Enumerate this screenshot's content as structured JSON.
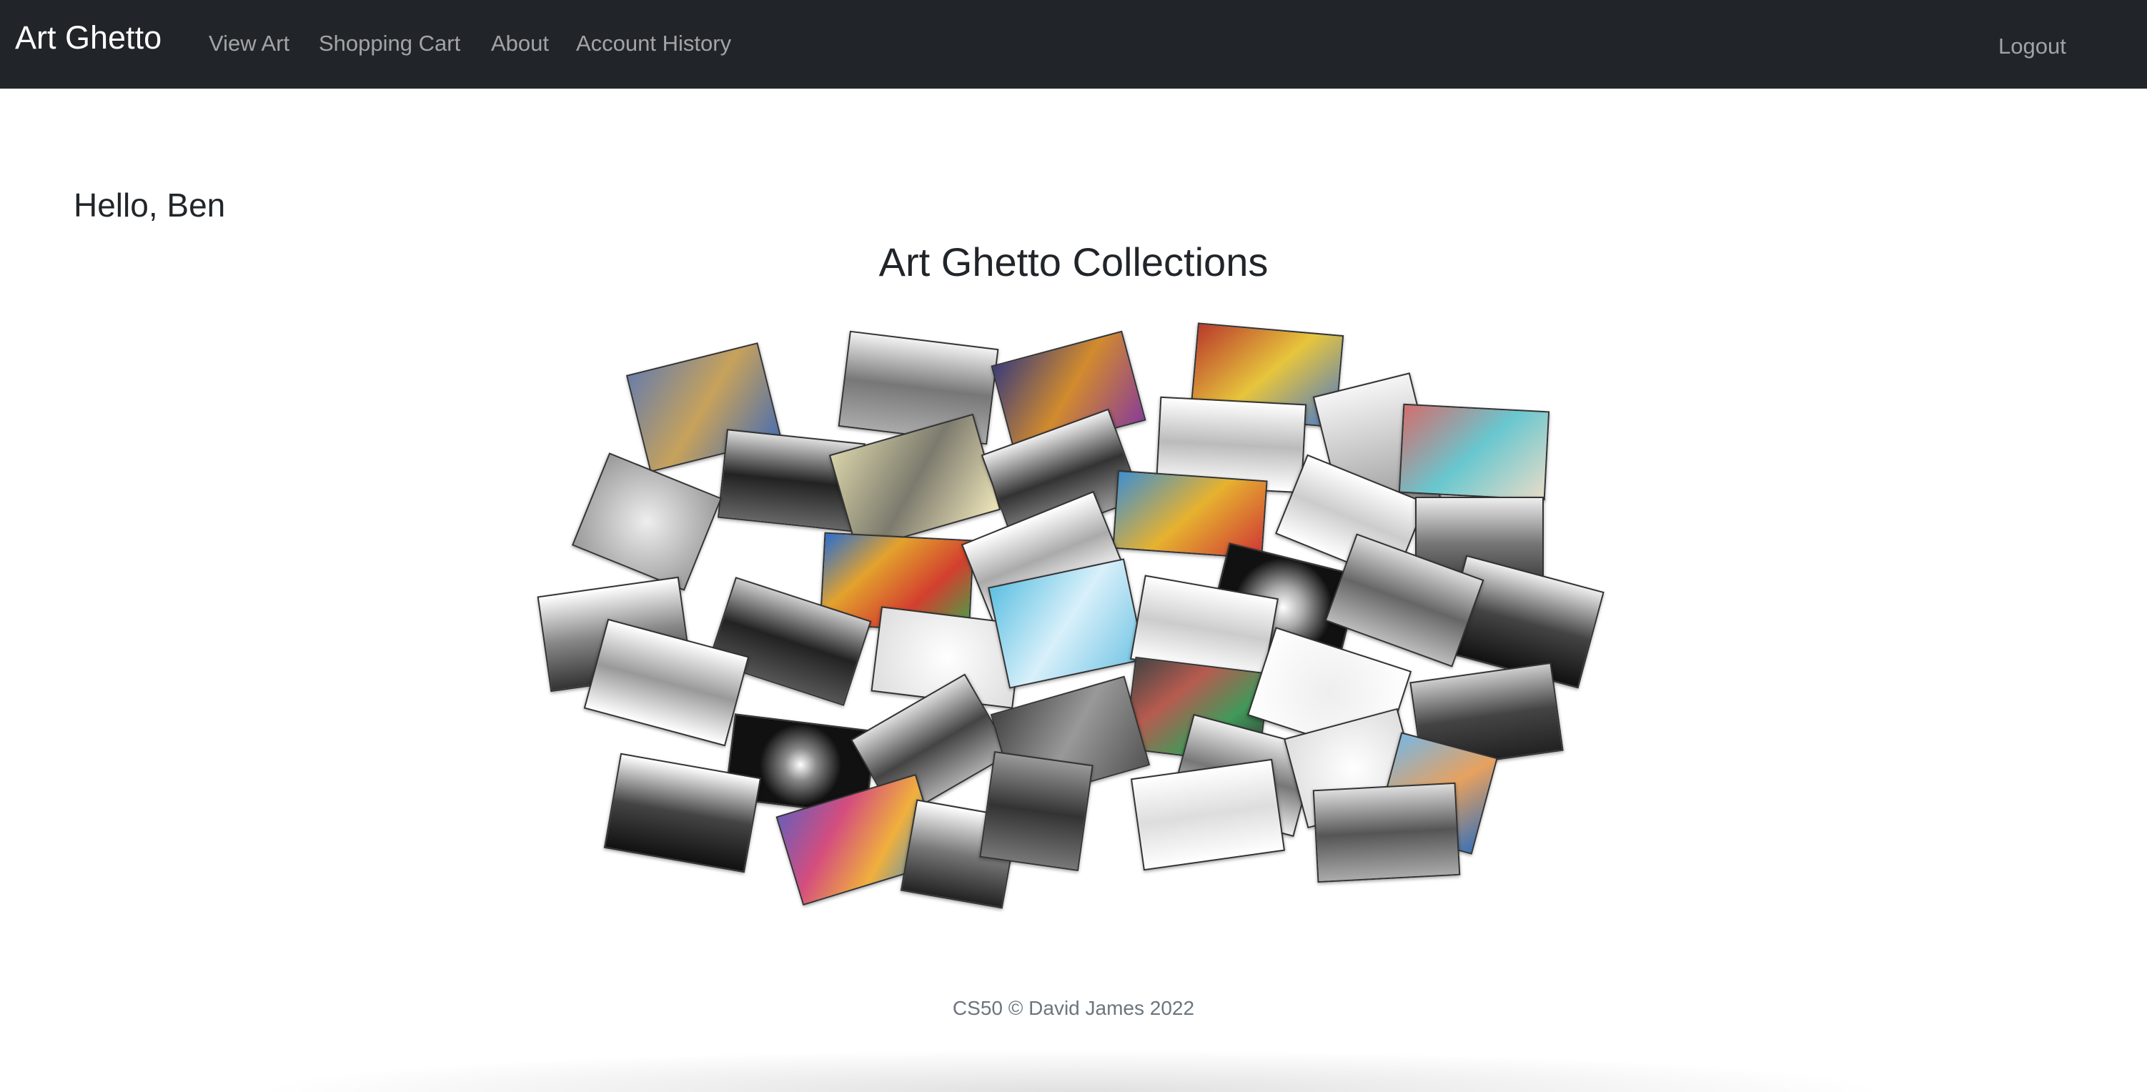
{
  "navbar": {
    "brand": "Art Ghetto",
    "links": [
      "View Art",
      "Shopping Cart",
      "About",
      "Account History"
    ],
    "logout": "Logout"
  },
  "main": {
    "greeting": "Hello, Ben",
    "title": "Art Ghetto Collections"
  },
  "footer": {
    "text": "CS50 © David James 2022"
  },
  "collage": {
    "description_icon": "photo-collage-image"
  }
}
